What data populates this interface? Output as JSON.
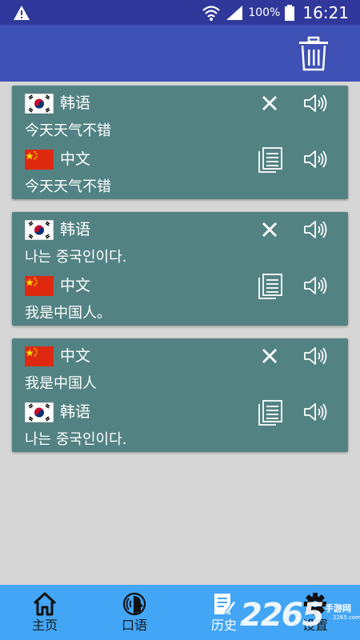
{
  "status_bar": {
    "battery_text": "100%",
    "time": "16:21",
    "icons": [
      "warning-icon",
      "wifi-icon",
      "signal-icon",
      "battery-icon"
    ]
  },
  "app_bar": {
    "action_icon": "trash-icon"
  },
  "history": [
    {
      "source_lang": "韩语",
      "source_flag": "korea",
      "source_text": "今天天气不错",
      "target_lang": "中文",
      "target_flag": "china",
      "target_text": "今天天气不错"
    },
    {
      "source_lang": "韩语",
      "source_flag": "korea",
      "source_text": "나는 중국인이다.",
      "target_lang": "中文",
      "target_flag": "china",
      "target_text": "我是中国人。"
    },
    {
      "source_lang": "中文",
      "source_flag": "china",
      "source_text": "我是中国人",
      "target_lang": "韩语",
      "target_flag": "korea",
      "target_text": "나는 중국인이다."
    }
  ],
  "bottom_nav": {
    "items": [
      {
        "label": "主页",
        "icon": "home-icon"
      },
      {
        "label": "口语",
        "icon": "speech-icon"
      },
      {
        "label": "历史",
        "icon": "history-icon",
        "active": true
      },
      {
        "label": "设置",
        "icon": "gear-icon"
      }
    ]
  },
  "watermark": {
    "big": "2265",
    "small": "手游网",
    "tiny": "2265.com"
  },
  "colors": {
    "status_bar": "#30399b",
    "app_bar": "#3f51b5",
    "card": "#538283",
    "background": "#d6d6d6",
    "bottom_nav": "#42a5f5"
  }
}
